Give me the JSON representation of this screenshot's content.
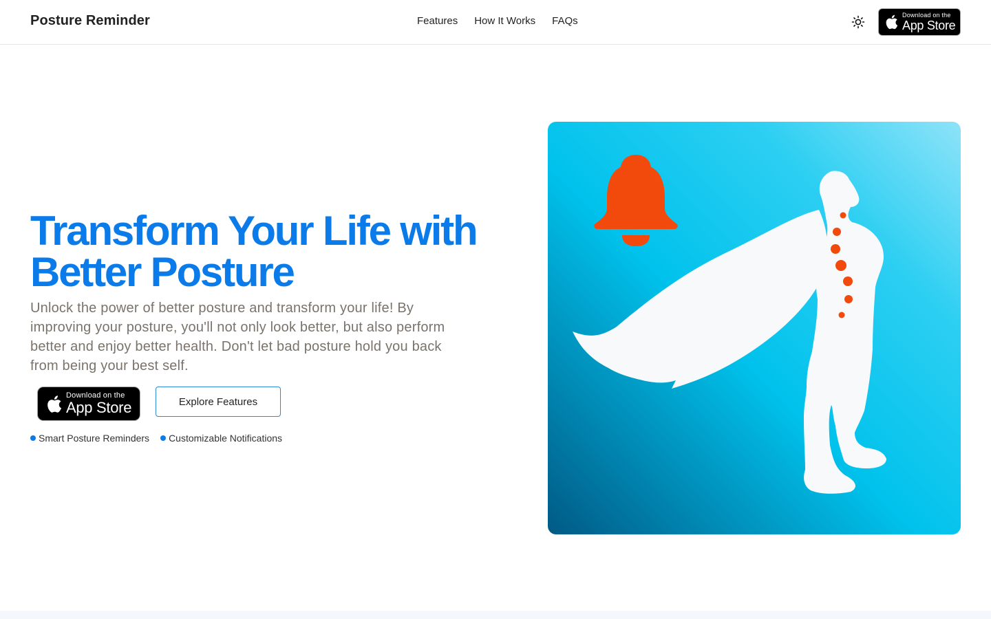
{
  "header": {
    "brand": "Posture Reminder",
    "nav": [
      "Features",
      "How It Works",
      "FAQs"
    ],
    "theme_icon": "sun-icon",
    "badge": {
      "small": "Download on the",
      "big": "App Store",
      "icon": "apple-icon"
    }
  },
  "hero": {
    "title": "Transform Your Life with Better Posture",
    "description": "Unlock the power of better posture and transform your life! By improving your posture, you'll not only look better, but also perform better and enjoy better health. Don't let bad posture hold you back from being your best self.",
    "badge": {
      "small": "Download on the",
      "big": "App Store",
      "icon": "apple-icon"
    },
    "explore_button": "Explore Features",
    "features": [
      "Smart Posture Reminders",
      "Customizable Notifications"
    ],
    "illustration": {
      "icons": [
        "bell-icon",
        "caped-figure",
        "spine-dots"
      ]
    }
  },
  "colors": {
    "accent": "#0a7be8",
    "text_muted": "#7a736b",
    "illustration_gradient": [
      "#005a85",
      "#00c2ec",
      "#8ee3f8"
    ],
    "bell": "#f24a0d",
    "figure": "#f8f9fb"
  }
}
